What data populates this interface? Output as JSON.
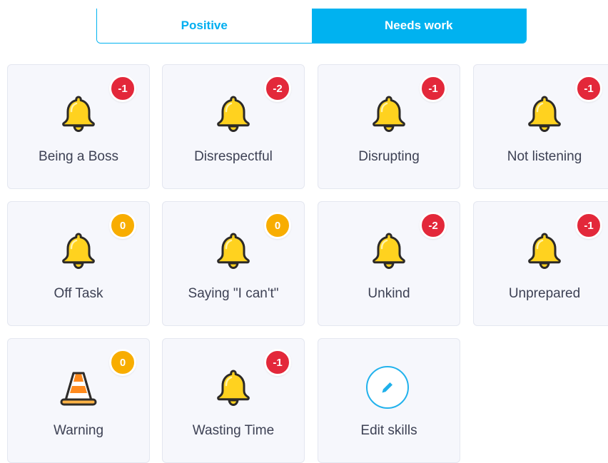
{
  "tabs": {
    "positive_label": "Positive",
    "needs_work_label": "Needs work",
    "active": "Needs work"
  },
  "colors": {
    "accent": "#00b2f0",
    "negative_badge": "#e3283a",
    "zero_badge": "#f8ad00",
    "card_bg": "#f6f7fc",
    "label_text": "#3d4154"
  },
  "skills": [
    {
      "label": "Being a Boss",
      "points": "-1",
      "icon": "bell-icon"
    },
    {
      "label": "Disrespectful",
      "points": "-2",
      "icon": "bell-icon"
    },
    {
      "label": "Disrupting",
      "points": "-1",
      "icon": "bell-icon"
    },
    {
      "label": "Not listening",
      "points": "-1",
      "icon": "bell-icon"
    },
    {
      "label": "Off Task",
      "points": "0",
      "icon": "bell-icon"
    },
    {
      "label": "Saying \"I can't\"",
      "points": "0",
      "icon": "bell-icon"
    },
    {
      "label": "Unkind",
      "points": "-2",
      "icon": "bell-icon"
    },
    {
      "label": "Unprepared",
      "points": "-1",
      "icon": "bell-icon"
    },
    {
      "label": "Warning",
      "points": "0",
      "icon": "traffic-cone-icon"
    },
    {
      "label": "Wasting Time",
      "points": "-1",
      "icon": "bell-icon"
    }
  ],
  "edit_skills": {
    "label": "Edit skills",
    "icon": "pencil-icon"
  }
}
